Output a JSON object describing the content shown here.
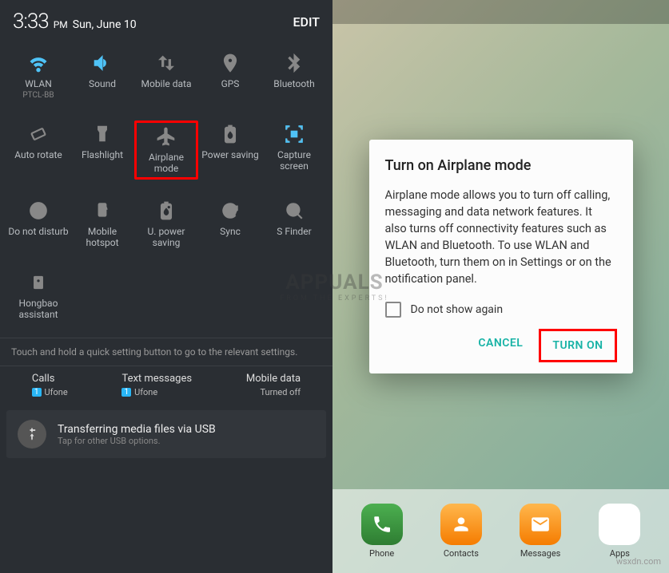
{
  "status": {
    "time": "3:33",
    "ampm": "PM",
    "date": "Sun, June 10",
    "edit": "EDIT"
  },
  "tiles": [
    {
      "icon": "wifi-icon",
      "label": "WLAN",
      "sub": "PTCL-BB",
      "active": true
    },
    {
      "icon": "sound-icon",
      "label": "Sound",
      "sub": "",
      "active": true
    },
    {
      "icon": "mobile-data-icon",
      "label": "Mobile data",
      "sub": "",
      "active": false
    },
    {
      "icon": "gps-icon",
      "label": "GPS",
      "sub": "",
      "active": false
    },
    {
      "icon": "bluetooth-icon",
      "label": "Bluetooth",
      "sub": "",
      "active": false
    },
    {
      "icon": "rotate-icon",
      "label": "Auto rotate",
      "sub": "",
      "active": false
    },
    {
      "icon": "flashlight-icon",
      "label": "Flashlight",
      "sub": "",
      "active": false
    },
    {
      "icon": "airplane-icon",
      "label": "Airplane mode",
      "sub": "",
      "active": false,
      "highlight": true
    },
    {
      "icon": "power-saving-icon",
      "label": "Power saving",
      "sub": "",
      "active": false
    },
    {
      "icon": "capture-icon",
      "label": "Capture screen",
      "sub": "",
      "active": false
    },
    {
      "icon": "dnd-icon",
      "label": "Do not disturb",
      "sub": "",
      "active": false
    },
    {
      "icon": "hotspot-icon",
      "label": "Mobile hotspot",
      "sub": "",
      "active": false
    },
    {
      "icon": "u-power-icon",
      "label": "U. power saving",
      "sub": "",
      "active": false
    },
    {
      "icon": "sync-icon",
      "label": "Sync",
      "sub": "",
      "active": false
    },
    {
      "icon": "sfinder-icon",
      "label": "S Finder",
      "sub": "",
      "active": false
    },
    {
      "icon": "hongbao-icon",
      "label": "Hongbao assistant",
      "sub": "",
      "active": false
    }
  ],
  "hint": "Touch and hold a quick setting button to go to the relevant settings.",
  "cards": {
    "calls": {
      "title": "Calls",
      "count": "1",
      "carrier": "Ufone"
    },
    "texts": {
      "title": "Text messages",
      "count": "1",
      "carrier": "Ufone"
    },
    "data": {
      "title": "Mobile data",
      "status": "Turned off"
    }
  },
  "usb": {
    "title": "Transferring media files via USB",
    "sub": "Tap for other USB options."
  },
  "dialog": {
    "title": "Turn on Airplane mode",
    "body": "Airplane mode allows you to turn off calling, messaging and data network features. It also turns off connectivity features such as WLAN and Bluetooth. To use WLAN and Bluetooth, turn them on in Settings or on the notification panel.",
    "checkbox_label": "Do not show again",
    "cancel": "CANCEL",
    "confirm": "TURN ON"
  },
  "dock": {
    "items": [
      {
        "label": "Phone",
        "icon": "phone-icon"
      },
      {
        "label": "Contacts",
        "icon": "contacts-icon"
      },
      {
        "label": "Messages",
        "icon": "messages-icon"
      },
      {
        "label": "Apps",
        "icon": "apps-icon"
      }
    ]
  },
  "watermark": {
    "main": "APPUALS",
    "sub": "FROM THE EXPERTS!",
    "corner": "wsxdn.com"
  }
}
